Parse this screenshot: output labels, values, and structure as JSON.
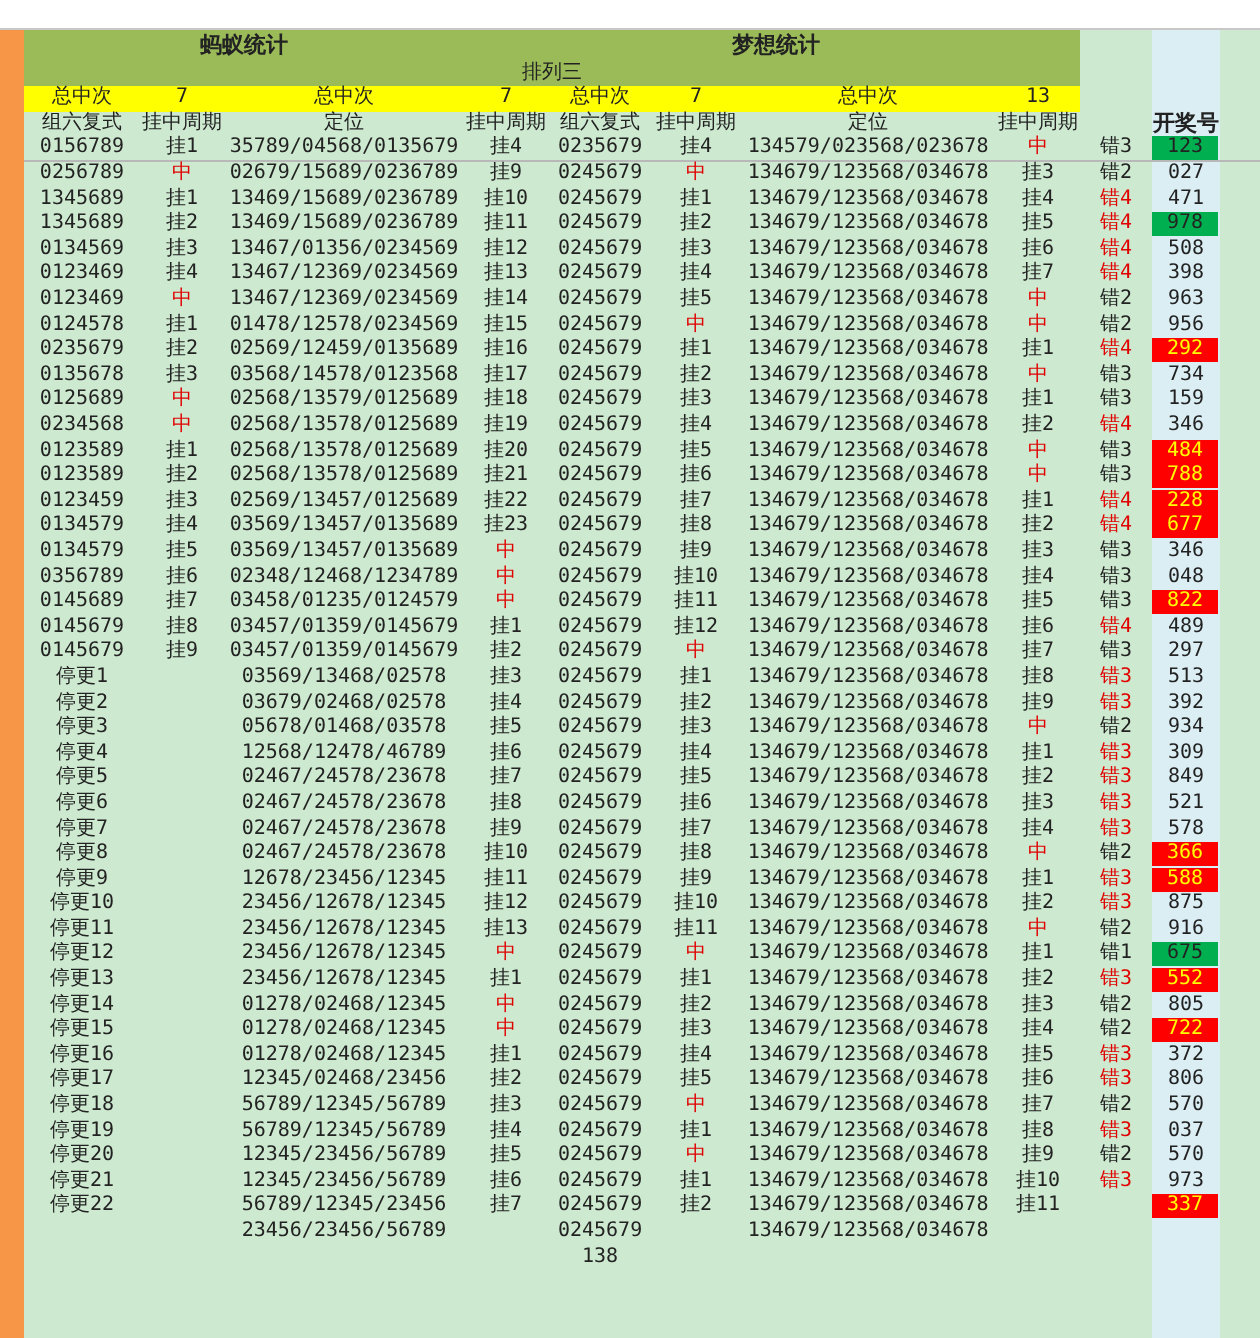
{
  "groups": [
    {
      "title": "蚂蚁统计"
    },
    {
      "title": "梦想统计"
    }
  ],
  "subtitle": "排列三",
  "summary": [
    "总中次",
    "7",
    "总中次",
    "7",
    "总中次",
    "7",
    "总中次",
    "13"
  ],
  "columns": [
    "组六复式",
    "挂中周期",
    "定位",
    "挂中周期",
    "组六复式",
    "挂中周期",
    "定位",
    "挂中周期"
  ],
  "result_column": "开奖号",
  "rows": [
    {
      "cells": [
        "0156789",
        "挂1",
        "35789/04568/0135679",
        "挂4",
        "0235679",
        "挂4",
        "134579/023568/023678",
        {
          "text": "中",
          "alert": true
        },
        "错3"
      ],
      "draw": {
        "text": "123",
        "color": "#00b050"
      }
    },
    {
      "cells": [
        "0256789",
        {
          "text": "中",
          "alert": true
        },
        "02679/15689/0236789",
        "挂9",
        "0245679",
        {
          "text": "中",
          "alert": true
        },
        "134679/123568/034678",
        "挂3",
        "错2"
      ],
      "draw": {
        "text": "027"
      }
    },
    {
      "cells": [
        "1345689",
        "挂1",
        "13469/15689/0236789",
        "挂10",
        "0245679",
        "挂1",
        "134679/123568/034678",
        "挂4",
        {
          "text": "错4",
          "alert": true
        }
      ],
      "draw": {
        "text": "471"
      }
    },
    {
      "cells": [
        "1345689",
        "挂2",
        "13469/15689/0236789",
        "挂11",
        "0245679",
        "挂2",
        "134679/123568/034678",
        "挂5",
        {
          "text": "错4",
          "alert": true
        }
      ],
      "draw": {
        "text": "978",
        "color": "#00b050"
      }
    },
    {
      "cells": [
        "0134569",
        "挂3",
        "13467/01356/0234569",
        "挂12",
        "0245679",
        "挂3",
        "134679/123568/034678",
        "挂6",
        {
          "text": "错4",
          "alert": true
        }
      ],
      "draw": {
        "text": "508"
      }
    },
    {
      "cells": [
        "0123469",
        "挂4",
        "13467/12369/0234569",
        "挂13",
        "0245679",
        "挂4",
        "134679/123568/034678",
        "挂7",
        {
          "text": "错4",
          "alert": true
        }
      ],
      "draw": {
        "text": "398"
      }
    },
    {
      "cells": [
        "0123469",
        {
          "text": "中",
          "alert": true
        },
        "13467/12369/0234569",
        "挂14",
        "0245679",
        "挂5",
        "134679/123568/034678",
        {
          "text": "中",
          "alert": true
        },
        "错2"
      ],
      "draw": {
        "text": "963"
      }
    },
    {
      "cells": [
        "0124578",
        "挂1",
        "01478/12578/0234569",
        "挂15",
        "0245679",
        {
          "text": "中",
          "alert": true
        },
        "134679/123568/034678",
        {
          "text": "中",
          "alert": true
        },
        "错2"
      ],
      "draw": {
        "text": "956"
      }
    },
    {
      "cells": [
        "0235679",
        "挂2",
        "02569/12459/0135689",
        "挂16",
        "0245679",
        "挂1",
        "134679/123568/034678",
        "挂1",
        {
          "text": "错4",
          "alert": true
        }
      ],
      "draw": {
        "text": "292",
        "color": "#ff0000"
      }
    },
    {
      "cells": [
        "0135678",
        "挂3",
        "03568/14578/0123568",
        "挂17",
        "0245679",
        "挂2",
        "134679/123568/034678",
        {
          "text": "中",
          "alert": true
        },
        "错3"
      ],
      "draw": {
        "text": "734"
      }
    },
    {
      "cells": [
        "0125689",
        {
          "text": "中",
          "alert": true
        },
        "02568/13579/0125689",
        "挂18",
        "0245679",
        "挂3",
        "134679/123568/034678",
        "挂1",
        "错3"
      ],
      "draw": {
        "text": "159"
      }
    },
    {
      "cells": [
        "0234568",
        {
          "text": "中",
          "alert": true
        },
        "02568/13578/0125689",
        "挂19",
        "0245679",
        "挂4",
        "134679/123568/034678",
        "挂2",
        {
          "text": "错4",
          "alert": true
        }
      ],
      "draw": {
        "text": "346"
      }
    },
    {
      "cells": [
        "0123589",
        "挂1",
        "02568/13578/0125689",
        "挂20",
        "0245679",
        "挂5",
        "134679/123568/034678",
        {
          "text": "中",
          "alert": true
        },
        "错3"
      ],
      "draw": {
        "text": "484",
        "color": "#ff0000"
      }
    },
    {
      "cells": [
        "0123589",
        "挂2",
        "02568/13578/0125689",
        "挂21",
        "0245679",
        "挂6",
        "134679/123568/034678",
        {
          "text": "中",
          "alert": true
        },
        "错3"
      ],
      "draw": {
        "text": "788",
        "color": "#ff0000"
      }
    },
    {
      "cells": [
        "0123459",
        "挂3",
        "02569/13457/0125689",
        "挂22",
        "0245679",
        "挂7",
        "134679/123568/034678",
        "挂1",
        {
          "text": "错4",
          "alert": true
        }
      ],
      "draw": {
        "text": "228",
        "color": "#ff0000"
      }
    },
    {
      "cells": [
        "0134579",
        "挂4",
        "03569/13457/0135689",
        "挂23",
        "0245679",
        "挂8",
        "134679/123568/034678",
        "挂2",
        {
          "text": "错4",
          "alert": true
        }
      ],
      "draw": {
        "text": "677",
        "color": "#ff0000"
      }
    },
    {
      "cells": [
        "0134579",
        "挂5",
        "03569/13457/0135689",
        {
          "text": "中",
          "alert": true
        },
        "0245679",
        "挂9",
        "134679/123568/034678",
        "挂3",
        "错3"
      ],
      "draw": {
        "text": "346"
      }
    },
    {
      "cells": [
        "0356789",
        "挂6",
        "02348/12468/1234789",
        {
          "text": "中",
          "alert": true
        },
        "0245679",
        "挂10",
        "134679/123568/034678",
        "挂4",
        "错3"
      ],
      "draw": {
        "text": "048"
      }
    },
    {
      "cells": [
        "0145689",
        "挂7",
        "03458/01235/0124579",
        {
          "text": "中",
          "alert": true
        },
        "0245679",
        "挂11",
        "134679/123568/034678",
        "挂5",
        "错3"
      ],
      "draw": {
        "text": "822",
        "color": "#ff0000"
      }
    },
    {
      "cells": [
        "0145679",
        "挂8",
        "03457/01359/0145679",
        "挂1",
        "0245679",
        "挂12",
        "134679/123568/034678",
        "挂6",
        {
          "text": "错4",
          "alert": true
        }
      ],
      "draw": {
        "text": "489"
      }
    },
    {
      "cells": [
        "0145679",
        "挂9",
        "03457/01359/0145679",
        "挂2",
        "0245679",
        {
          "text": "中",
          "alert": true
        },
        "134679/123568/034678",
        "挂7",
        "错3"
      ],
      "draw": {
        "text": "297"
      }
    },
    {
      "cells": [
        "停更1",
        "",
        "03569/13468/02578",
        "挂3",
        "0245679",
        "挂1",
        "134679/123568/034678",
        "挂8",
        {
          "text": "错3",
          "alert": true
        }
      ],
      "draw": {
        "text": "513"
      }
    },
    {
      "cells": [
        "停更2",
        "",
        "03679/02468/02578",
        "挂4",
        "0245679",
        "挂2",
        "134679/123568/034678",
        "挂9",
        {
          "text": "错3",
          "alert": true
        }
      ],
      "draw": {
        "text": "392"
      }
    },
    {
      "cells": [
        "停更3",
        "",
        "05678/01468/03578",
        "挂5",
        "0245679",
        "挂3",
        "134679/123568/034678",
        {
          "text": "中",
          "alert": true
        },
        "错2"
      ],
      "draw": {
        "text": "934"
      }
    },
    {
      "cells": [
        "停更4",
        "",
        "12568/12478/46789",
        "挂6",
        "0245679",
        "挂4",
        "134679/123568/034678",
        "挂1",
        {
          "text": "错3",
          "alert": true
        }
      ],
      "draw": {
        "text": "309"
      }
    },
    {
      "cells": [
        "停更5",
        "",
        "02467/24578/23678",
        "挂7",
        "0245679",
        "挂5",
        "134679/123568/034678",
        "挂2",
        {
          "text": "错3",
          "alert": true
        }
      ],
      "draw": {
        "text": "849"
      }
    },
    {
      "cells": [
        "停更6",
        "",
        "02467/24578/23678",
        "挂8",
        "0245679",
        "挂6",
        "134679/123568/034678",
        "挂3",
        {
          "text": "错3",
          "alert": true
        }
      ],
      "draw": {
        "text": "521"
      }
    },
    {
      "cells": [
        "停更7",
        "",
        "02467/24578/23678",
        "挂9",
        "0245679",
        "挂7",
        "134679/123568/034678",
        "挂4",
        {
          "text": "错3",
          "alert": true
        }
      ],
      "draw": {
        "text": "578"
      }
    },
    {
      "cells": [
        "停更8",
        "",
        "02467/24578/23678",
        "挂10",
        "0245679",
        "挂8",
        "134679/123568/034678",
        {
          "text": "中",
          "alert": true
        },
        "错2"
      ],
      "draw": {
        "text": "366",
        "color": "#ff0000"
      }
    },
    {
      "cells": [
        "停更9",
        "",
        "12678/23456/12345",
        "挂11",
        "0245679",
        "挂9",
        "134679/123568/034678",
        "挂1",
        {
          "text": "错3",
          "alert": true
        }
      ],
      "draw": {
        "text": "588",
        "color": "#ff0000"
      }
    },
    {
      "cells": [
        "停更10",
        "",
        "23456/12678/12345",
        "挂12",
        "0245679",
        "挂10",
        "134679/123568/034678",
        "挂2",
        {
          "text": "错3",
          "alert": true
        }
      ],
      "draw": {
        "text": "875"
      }
    },
    {
      "cells": [
        "停更11",
        "",
        "23456/12678/12345",
        "挂13",
        "0245679",
        "挂11",
        "134679/123568/034678",
        {
          "text": "中",
          "alert": true
        },
        "错2"
      ],
      "draw": {
        "text": "916"
      }
    },
    {
      "cells": [
        "停更12",
        "",
        "23456/12678/12345",
        {
          "text": "中",
          "alert": true
        },
        "0245679",
        {
          "text": "中",
          "alert": true
        },
        "134679/123568/034678",
        "挂1",
        "错1"
      ],
      "draw": {
        "text": "675",
        "color": "#00b050"
      }
    },
    {
      "cells": [
        "停更13",
        "",
        "23456/12678/12345",
        "挂1",
        "0245679",
        "挂1",
        "134679/123568/034678",
        "挂2",
        {
          "text": "错3",
          "alert": true
        }
      ],
      "draw": {
        "text": "552",
        "color": "#ff0000"
      }
    },
    {
      "cells": [
        "停更14",
        "",
        "01278/02468/12345",
        {
          "text": "中",
          "alert": true
        },
        "0245679",
        "挂2",
        "134679/123568/034678",
        "挂3",
        "错2"
      ],
      "draw": {
        "text": "805"
      }
    },
    {
      "cells": [
        "停更15",
        "",
        "01278/02468/12345",
        {
          "text": "中",
          "alert": true
        },
        "0245679",
        "挂3",
        "134679/123568/034678",
        "挂4",
        "错2"
      ],
      "draw": {
        "text": "722",
        "color": "#ff0000"
      }
    },
    {
      "cells": [
        "停更16",
        "",
        "01278/02468/12345",
        "挂1",
        "0245679",
        "挂4",
        "134679/123568/034678",
        "挂5",
        {
          "text": "错3",
          "alert": true
        }
      ],
      "draw": {
        "text": "372"
      }
    },
    {
      "cells": [
        "停更17",
        "",
        "12345/02468/23456",
        "挂2",
        "0245679",
        "挂5",
        "134679/123568/034678",
        "挂6",
        {
          "text": "错3",
          "alert": true
        }
      ],
      "draw": {
        "text": "806"
      }
    },
    {
      "cells": [
        "停更18",
        "",
        "56789/12345/56789",
        "挂3",
        "0245679",
        {
          "text": "中",
          "alert": true
        },
        "134679/123568/034678",
        "挂7",
        "错2"
      ],
      "draw": {
        "text": "570"
      }
    },
    {
      "cells": [
        "停更19",
        "",
        "56789/12345/56789",
        "挂4",
        "0245679",
        "挂1",
        "134679/123568/034678",
        "挂8",
        {
          "text": "错3",
          "alert": true
        }
      ],
      "draw": {
        "text": "037"
      }
    },
    {
      "cells": [
        "停更20",
        "",
        "12345/23456/56789",
        "挂5",
        "0245679",
        {
          "text": "中",
          "alert": true
        },
        "134679/123568/034678",
        "挂9",
        "错2"
      ],
      "draw": {
        "text": "570"
      }
    },
    {
      "cells": [
        "停更21",
        "",
        "12345/23456/56789",
        "挂6",
        "0245679",
        "挂1",
        "134679/123568/034678",
        "挂10",
        {
          "text": "错3",
          "alert": true
        }
      ],
      "draw": {
        "text": "973"
      }
    },
    {
      "cells": [
        "停更22",
        "",
        "56789/12345/23456",
        "挂7",
        "0245679",
        "挂2",
        "134679/123568/034678",
        "挂11",
        ""
      ],
      "draw": {
        "text": "337",
        "color": "#ff0000"
      }
    },
    {
      "cells": [
        "",
        "",
        "23456/23456/56789",
        "",
        "0245679",
        "",
        "134679/123568/034678",
        "",
        ""
      ]
    }
  ],
  "total": "138"
}
